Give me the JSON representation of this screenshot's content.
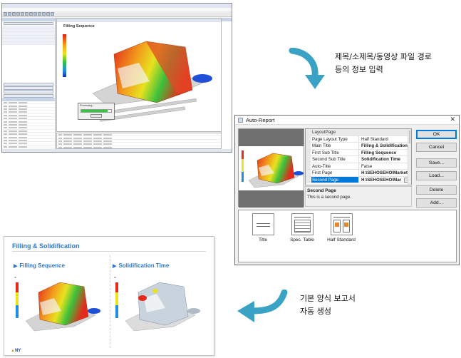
{
  "annotations": {
    "step1_line1": "제목/소제목/동영상 파일 경로",
    "step1_line2": "등의 정보 입력",
    "step2_line1": "기본 양식 보고서",
    "step2_line2": "자동 생성"
  },
  "colors": {
    "arrow": "#3aa2c4",
    "accent_blue": "#2c78d4",
    "selection": "#0078d7",
    "progress": "#2ecb3b"
  },
  "app_window": {
    "viewport_label": "Filling Sequence",
    "progress_caption": "Processing..."
  },
  "dialog": {
    "title": "Auto-Report",
    "close_icon": "close-icon",
    "category": "LayoutPage",
    "properties": [
      {
        "name": "Page Layout Type",
        "value": "Half Standard",
        "bold": false
      },
      {
        "name": "Main Title",
        "value": "Filling & Solidification",
        "bold": true
      },
      {
        "name": "First Sub Title",
        "value": "Filling Sequence",
        "bold": true
      },
      {
        "name": "Second Sub Title",
        "value": "Solidification Time",
        "bold": true
      },
      {
        "name": "Auto-Title",
        "value": "False",
        "bold": false
      },
      {
        "name": "First Page",
        "value": "H:\\SEHOSEHO\\Market",
        "bold": true
      },
      {
        "name": "Second Page",
        "value": "H:\\SEHOSEHO\\Mar",
        "bold": true
      }
    ],
    "selected_property": "Second Page",
    "description_title": "Second Page",
    "description_text": "This is a second page.",
    "buttons": {
      "ok": "OK",
      "cancel": "Cancel",
      "save": "Save...",
      "load": "Load...",
      "delete": "Delete",
      "add": "Add..."
    },
    "templates": [
      {
        "label": "Title",
        "icon": "title-layout-icon"
      },
      {
        "label": "Spec. Table",
        "icon": "spec-table-layout-icon"
      },
      {
        "label": "Half Standard",
        "icon": "half-standard-layout-icon"
      }
    ]
  },
  "report": {
    "main_title": "Filling & Solidification",
    "sub_title_1": "Filling Sequence",
    "sub_title_2": "Solidification Time",
    "logo": "NY"
  }
}
